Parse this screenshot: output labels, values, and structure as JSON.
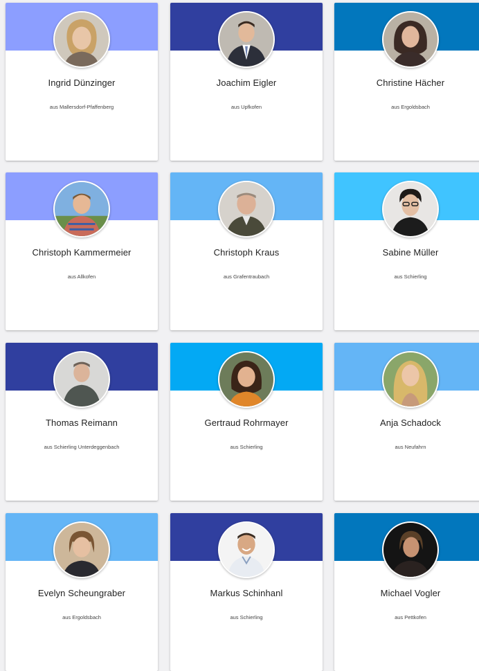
{
  "colors": {
    "periwinkle": "#8c9eff",
    "navy": "#303f9f",
    "blue": "#0277bd",
    "sky": "#64b5f6",
    "cyan": "#40c4ff",
    "bright_cyan": "#03a9f4"
  },
  "members": [
    {
      "name": "Ingrid  Dünzinger",
      "origin": "aus Mallersdorf-Pfaffenberg",
      "banner": "#8c9eff",
      "photo": "portrait-woman-blonde"
    },
    {
      "name": "Joachim Eigler",
      "origin": "aus Upfkofen",
      "banner": "#303f9f",
      "photo": "portrait-man-suit"
    },
    {
      "name": "Christine Hächer",
      "origin": "aus Ergoldsbach",
      "banner": "#0277bd",
      "photo": "portrait-woman-dark-hair"
    },
    {
      "name": "Christoph Kammermeier",
      "origin": "aus Allkofen",
      "banner": "#8c9eff",
      "photo": "portrait-man-outdoor"
    },
    {
      "name": "Christoph Kraus",
      "origin": "aus Grafentraubach",
      "banner": "#64b5f6",
      "photo": "portrait-man-bald"
    },
    {
      "name": "Sabine Müller",
      "origin": "aus Schierling",
      "banner": "#40c4ff",
      "photo": "portrait-woman-glasses"
    },
    {
      "name": "Thomas Reimann",
      "origin": "aus Schierling Unterdeggenbach",
      "banner": "#303f9f",
      "photo": "portrait-man-casual"
    },
    {
      "name": "Gertraud Rohrmayer",
      "origin": "aus Schierling",
      "banner": "#03a9f4",
      "photo": "portrait-woman-brunette"
    },
    {
      "name": "Anja Schadock",
      "origin": "aus Neufahrn",
      "banner": "#64b5f6",
      "photo": "portrait-woman-long-blonde"
    },
    {
      "name": "Evelyn Scheungraber",
      "origin": "aus Ergoldsbach",
      "banner": "#64b5f6",
      "photo": "portrait-woman-short-hair"
    },
    {
      "name": "Markus Schinhanl",
      "origin": "aus Schierling",
      "banner": "#303f9f",
      "photo": "portrait-man-smiling"
    },
    {
      "name": "Michael Vogler",
      "origin": "aus Pettkofen",
      "banner": "#0277bd",
      "photo": "portrait-man-dark"
    }
  ]
}
